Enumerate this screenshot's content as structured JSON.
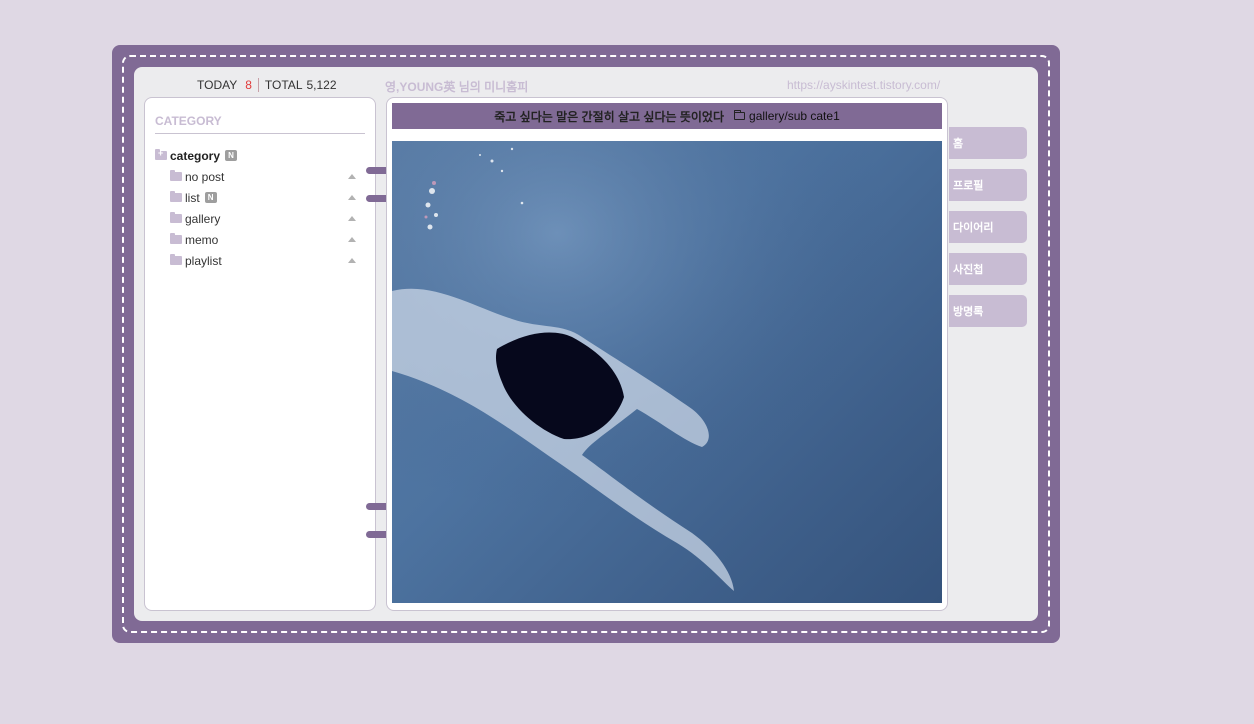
{
  "counter": {
    "today_label": "TODAY",
    "today_value": "8",
    "total_label": "TOTAL",
    "total_value": "5,122"
  },
  "site": {
    "title": "영,YOUNG英 님의 미니홈피",
    "url": "https://ayskintest.tistory.com/"
  },
  "sidebar": {
    "heading": "CATEGORY",
    "root": {
      "label": "category",
      "badge": "N"
    },
    "items": [
      {
        "label": "no post"
      },
      {
        "label": "list",
        "badge": "N"
      },
      {
        "label": "gallery"
      },
      {
        "label": "memo"
      },
      {
        "label": "playlist"
      }
    ]
  },
  "post": {
    "title": "죽고 싶다는 말은 간절히 살고 싶다는 뜻이었다",
    "path": "gallery/sub cate1"
  },
  "nav": [
    {
      "label": "홈"
    },
    {
      "label": "프로필"
    },
    {
      "label": "다이어리"
    },
    {
      "label": "사진첩"
    },
    {
      "label": "방명록"
    }
  ],
  "colors": {
    "frame": "#806a95",
    "accent": "#c8bcd3",
    "today_count": "#e23a3a",
    "background": "#dfd8e4"
  }
}
